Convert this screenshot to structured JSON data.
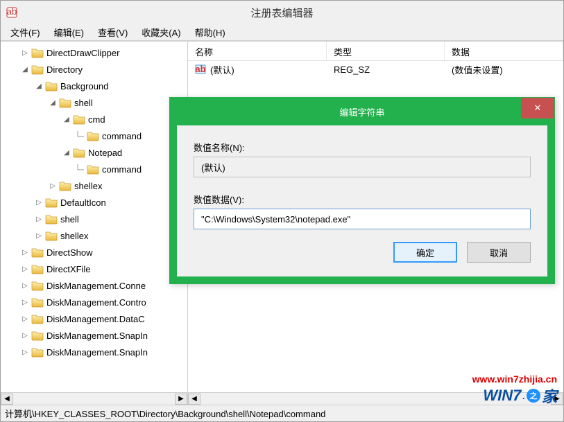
{
  "window": {
    "title": "注册表编辑器"
  },
  "menu": {
    "file": "文件(F)",
    "edit": "编辑(E)",
    "view": "查看(V)",
    "favorites": "收藏夹(A)",
    "help": "帮助(H)"
  },
  "tree": {
    "items": [
      {
        "indent": 1,
        "expander": "right",
        "label": "DirectDrawClipper"
      },
      {
        "indent": 1,
        "expander": "down",
        "label": "Directory"
      },
      {
        "indent": 2,
        "expander": "down",
        "label": "Background"
      },
      {
        "indent": 3,
        "expander": "down",
        "label": "shell"
      },
      {
        "indent": 4,
        "expander": "down",
        "label": "cmd"
      },
      {
        "indent": 5,
        "expander": "none",
        "label": "command",
        "connector": true
      },
      {
        "indent": 4,
        "expander": "down",
        "label": "Notepad"
      },
      {
        "indent": 5,
        "expander": "none",
        "label": "command",
        "connector": true
      },
      {
        "indent": 3,
        "expander": "right",
        "label": "shellex"
      },
      {
        "indent": 2,
        "expander": "right",
        "label": "DefaultIcon"
      },
      {
        "indent": 2,
        "expander": "right",
        "label": "shell"
      },
      {
        "indent": 2,
        "expander": "right",
        "label": "shellex"
      },
      {
        "indent": 1,
        "expander": "right",
        "label": "DirectShow"
      },
      {
        "indent": 1,
        "expander": "right",
        "label": "DirectXFile"
      },
      {
        "indent": 1,
        "expander": "right",
        "label": "DiskManagement.Conne"
      },
      {
        "indent": 1,
        "expander": "right",
        "label": "DiskManagement.Contro"
      },
      {
        "indent": 1,
        "expander": "right",
        "label": "DiskManagement.DataC"
      },
      {
        "indent": 1,
        "expander": "right",
        "label": "DiskManagement.SnapIn"
      },
      {
        "indent": 1,
        "expander": "right",
        "label": "DiskManagement.SnapIn"
      }
    ]
  },
  "list": {
    "columns": {
      "name": "名称",
      "type": "类型",
      "data": "数据"
    },
    "row": {
      "name": "(默认)",
      "type": "REG_SZ",
      "data": "(数值未设置)"
    }
  },
  "dialog": {
    "title": "编辑字符串",
    "label_name": "数值名称(N):",
    "value_name": "(默认)",
    "label_data": "数值数据(V):",
    "value_data": "\"C:\\Windows\\System32\\notepad.exe\"",
    "ok": "确定",
    "cancel": "取消"
  },
  "statusbar": {
    "path": "计算机\\HKEY_CLASSES_ROOT\\Directory\\Background\\shell\\Notepad\\command"
  },
  "watermark": {
    "url": "www.win7zhijia.cn",
    "logo": "WIN7.之家"
  }
}
